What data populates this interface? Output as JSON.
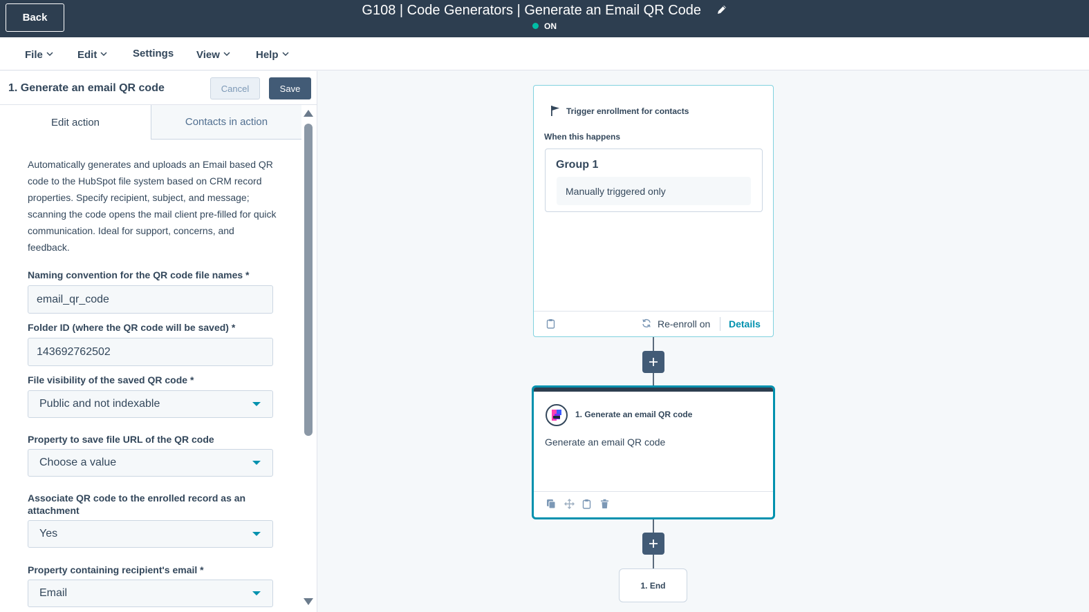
{
  "header": {
    "back_label": "Back",
    "title": "G108 | Code Generators | Generate an Email QR Code",
    "status": "ON",
    "status_color": "#00bda5",
    "edit_icon": "pencil-icon"
  },
  "menu": {
    "items": [
      {
        "label": "File",
        "has_dropdown": true
      },
      {
        "label": "Edit",
        "has_dropdown": true
      },
      {
        "label": "Settings",
        "has_dropdown": false
      },
      {
        "label": "View",
        "has_dropdown": true
      },
      {
        "label": "Help",
        "has_dropdown": true
      }
    ]
  },
  "panel": {
    "title": "1. Generate an email QR code",
    "cancel_label": "Cancel",
    "save_label": "Save",
    "tabs": [
      {
        "label": "Edit action",
        "active": true
      },
      {
        "label": "Contacts in action",
        "active": false
      }
    ],
    "description": "Automatically generates and uploads an Email based QR code to the HubSpot file system based on CRM record properties. Specify recipient, subject, and message; scanning the code opens the mail client pre-filled for quick communication. Ideal for support, concerns, and feedback.",
    "fields": [
      {
        "label": "Naming convention for the QR code file names *",
        "type": "text",
        "value": "email_qr_code"
      },
      {
        "label": "Folder ID (where the QR code will be saved) *",
        "type": "text",
        "value": "143692762502"
      },
      {
        "label": "File visibility of the saved QR code *",
        "type": "select",
        "value": "Public and not indexable"
      },
      {
        "label": "Property to save file URL of the QR code",
        "type": "select",
        "value": "Choose a value"
      },
      {
        "label": "Associate QR code to the enrolled record as an attachment",
        "type": "select",
        "value": "Yes"
      },
      {
        "label": "Property containing recipient's email *",
        "type": "select",
        "value": "Email"
      }
    ]
  },
  "canvas": {
    "trigger": {
      "title": "Trigger enrollment for contacts",
      "when_label": "When this happens",
      "group_title": "Group 1",
      "group_condition": "Manually triggered only",
      "reenroll_label": "Re-enroll on",
      "details_label": "Details"
    },
    "action": {
      "title": "1. Generate an email QR code",
      "description": "Generate an email QR code"
    },
    "end_label": "1. End"
  },
  "colors": {
    "header_bg": "#2d3e50",
    "accent": "#0091ae",
    "button_dark": "#425b76"
  }
}
